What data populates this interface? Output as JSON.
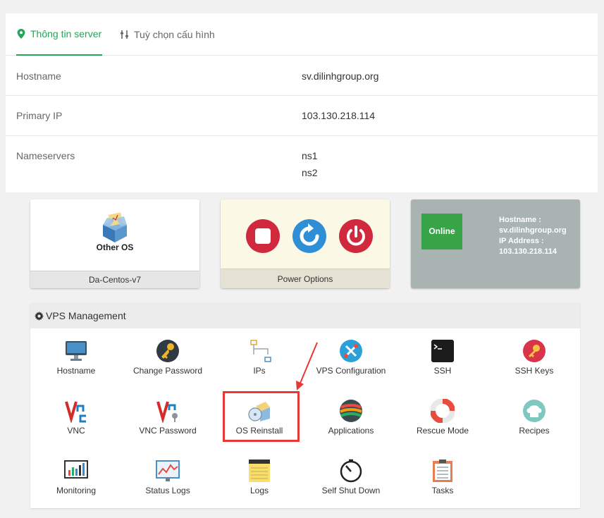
{
  "tabs": [
    {
      "label": "Thông tin server",
      "icon": "map-pin-icon",
      "active": true
    },
    {
      "label": "Tuỳ chọn cấu hình",
      "icon": "sliders-icon",
      "active": false
    }
  ],
  "server_info": [
    {
      "key": "Hostname",
      "values": [
        "sv.dilinhgroup.org"
      ]
    },
    {
      "key": "Primary IP",
      "values": [
        "103.130.218.114"
      ]
    },
    {
      "key": "Nameservers",
      "values": [
        "ns1",
        "ns2"
      ]
    }
  ],
  "os_box": {
    "os_name": "Other OS",
    "template": "Da-Centos-v7"
  },
  "power_box": {
    "label": "Power Options"
  },
  "status_box": {
    "status": "Online",
    "hostname_label": "Hostname :",
    "hostname": "sv.dilinhgroup.org",
    "ip_label": "IP Address :",
    "ip": "103.130.218.114"
  },
  "vps_management": {
    "title": "VPS Management",
    "tools": [
      {
        "label": "Hostname",
        "icon": "monitor-icon"
      },
      {
        "label": "Change Password",
        "icon": "key-icon"
      },
      {
        "label": "IPs",
        "icon": "network-icon"
      },
      {
        "label": "VPS Configuration",
        "icon": "tools-icon"
      },
      {
        "label": "SSH",
        "icon": "terminal-icon"
      },
      {
        "label": "SSH Keys",
        "icon": "ssh-key-icon"
      },
      {
        "label": "VNC",
        "icon": "vnc-icon"
      },
      {
        "label": "VNC Password",
        "icon": "vnc-password-icon"
      },
      {
        "label": "OS Reinstall",
        "icon": "os-reinstall-icon"
      },
      {
        "label": "Applications",
        "icon": "applications-icon"
      },
      {
        "label": "Rescue Mode",
        "icon": "lifebuoy-icon"
      },
      {
        "label": "Recipes",
        "icon": "chef-hat-icon"
      },
      {
        "label": "Monitoring",
        "icon": "monitoring-chart-icon"
      },
      {
        "label": "Status Logs",
        "icon": "status-logs-icon"
      },
      {
        "label": "Logs",
        "icon": "notepad-icon"
      },
      {
        "label": "Self Shut Down",
        "icon": "timer-icon"
      },
      {
        "label": "Tasks",
        "icon": "tasks-icon"
      }
    ]
  },
  "colors": {
    "accent": "#22a559",
    "danger": "#d0283d",
    "info": "#2f8fd6",
    "online": "#37a447",
    "annotation": "#e53935"
  }
}
